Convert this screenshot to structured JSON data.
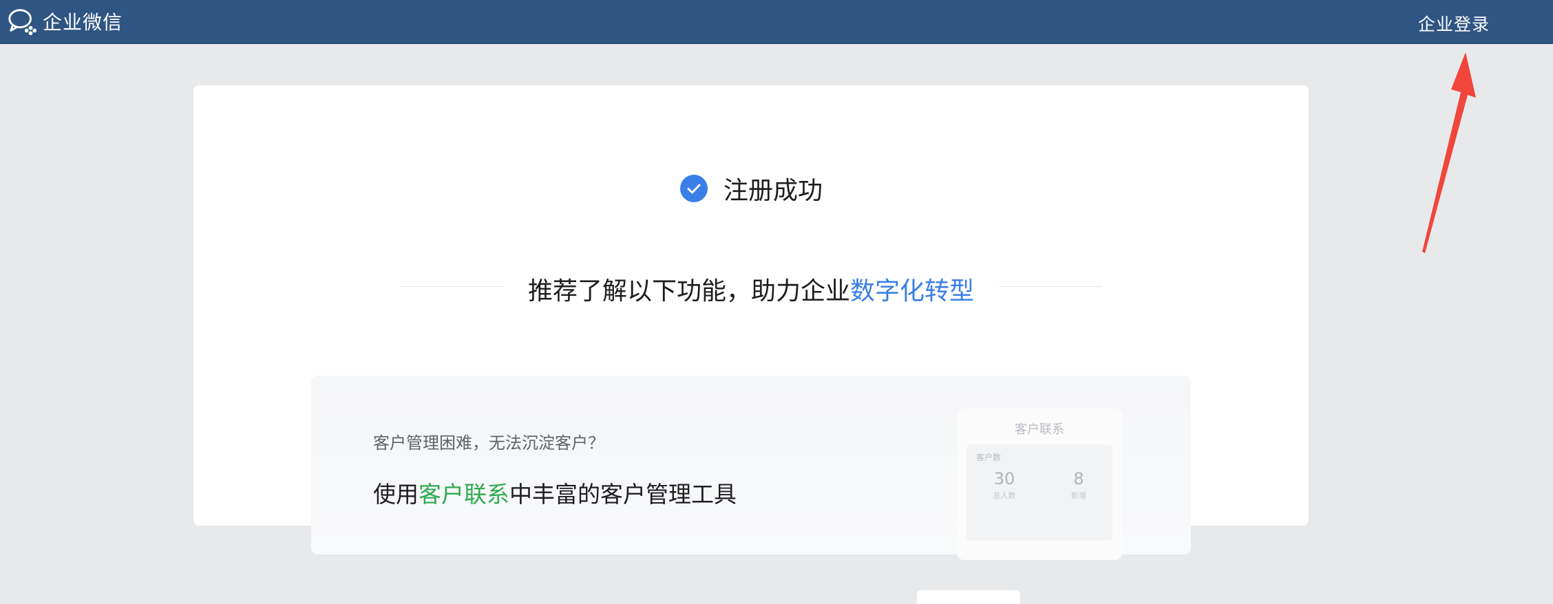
{
  "header": {
    "brand_name": "企业微信",
    "login_label": "企业登录"
  },
  "status": {
    "success_text": "注册成功"
  },
  "recommend": {
    "prefix": "推荐了解以下功能，助力企业",
    "highlight": "数字化转型"
  },
  "feature": {
    "question": "客户管理困难，无法沉淀客户？",
    "title_prefix": "使用",
    "title_highlight": "客户联系",
    "title_suffix": "中丰富的客户管理工具",
    "mock": {
      "title": "客户联系",
      "label": "客户数",
      "stats": [
        {
          "value": "30",
          "caption": "总人数"
        },
        {
          "value": "8",
          "caption": "新增"
        }
      ]
    }
  },
  "colors": {
    "topbar": "#2f5582",
    "accent_blue": "#3a7ee8",
    "accent_green": "#2daa4f",
    "annotation_red": "#f0463c"
  },
  "icons": {
    "brand": "wecom-logo-icon",
    "success": "check-circle-icon"
  }
}
